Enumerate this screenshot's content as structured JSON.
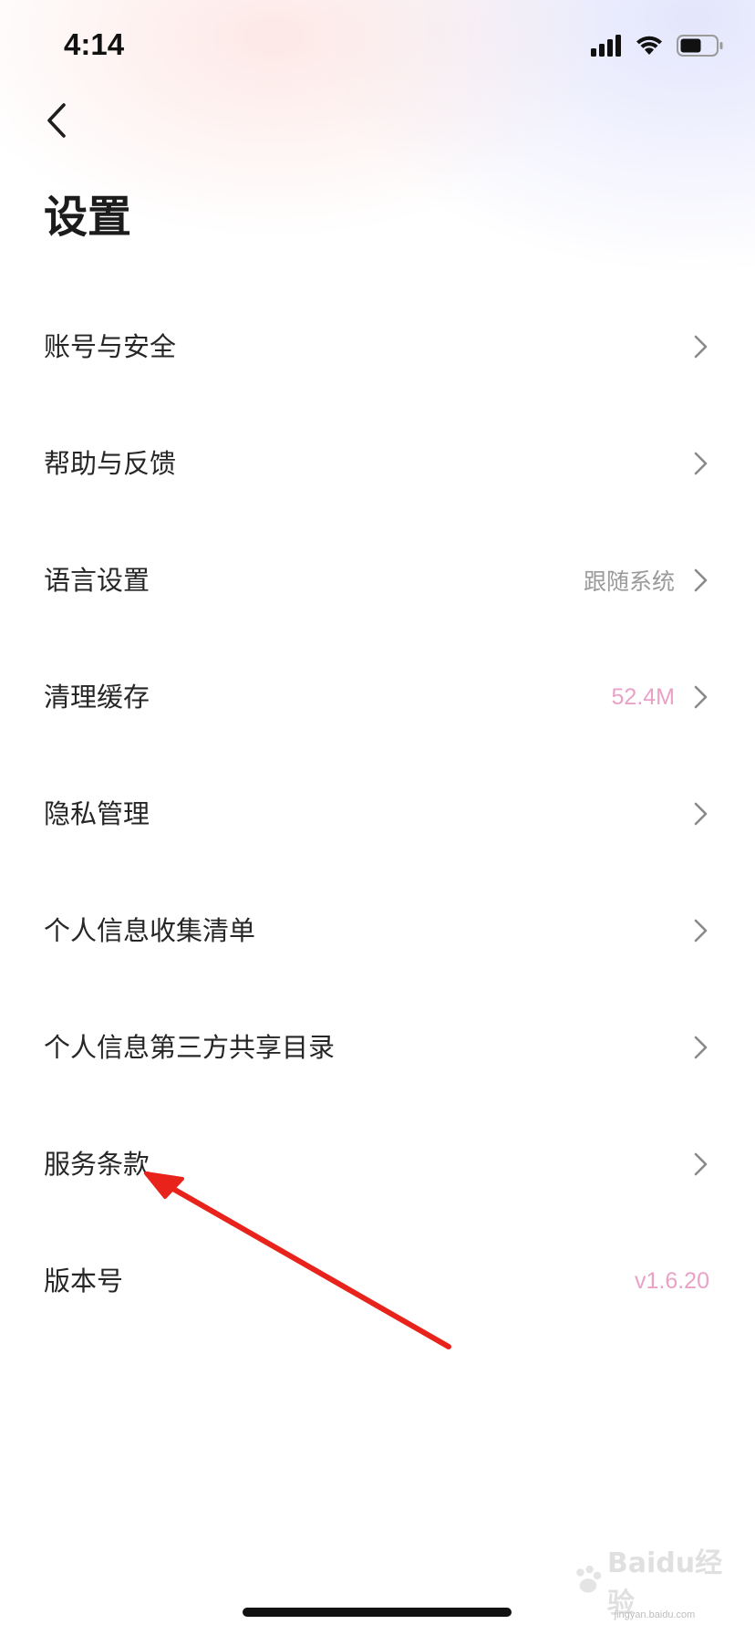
{
  "status_bar": {
    "time": "4:14"
  },
  "header": {
    "title": "设置"
  },
  "settings": {
    "items": [
      {
        "label": "账号与安全",
        "value": ""
      },
      {
        "label": "帮助与反馈",
        "value": ""
      },
      {
        "label": "语言设置",
        "value": "跟随系统"
      },
      {
        "label": "清理缓存",
        "value": "52.4M"
      },
      {
        "label": "隐私管理",
        "value": ""
      },
      {
        "label": "个人信息收集清单",
        "value": ""
      },
      {
        "label": "个人信息第三方共享目录",
        "value": ""
      },
      {
        "label": "服务条款",
        "value": ""
      },
      {
        "label": "版本号",
        "value": "v1.6.20"
      }
    ]
  },
  "watermark": {
    "text": "Baidu经验",
    "sub": "jingyan.baidu.com"
  },
  "colors": {
    "accent_pink": "#e9a2c6",
    "annotation_arrow": "#e8231b"
  },
  "icons": {
    "back": "chevron-left-icon",
    "row": "chevron-right-icon"
  }
}
